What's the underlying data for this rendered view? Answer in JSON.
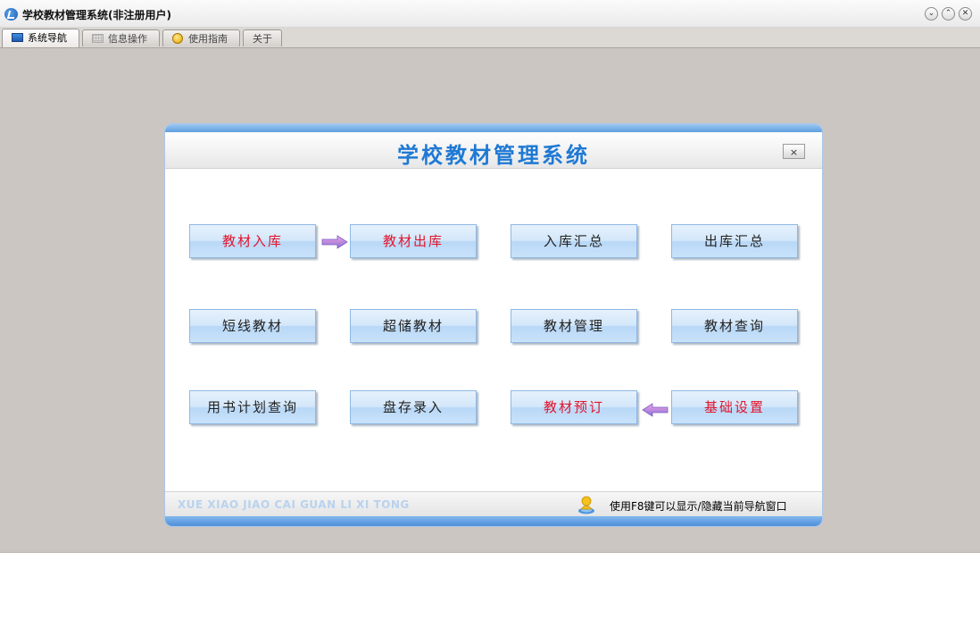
{
  "window": {
    "title": "学校教材管理系统(非注册用户)",
    "controls": [
      "⌄",
      "⌃",
      "✕"
    ]
  },
  "tabs": [
    {
      "label": "系统导航",
      "icon": "monitor-icon",
      "active": true
    },
    {
      "label": "信息操作",
      "icon": "grid-icon",
      "active": false
    },
    {
      "label": "使用指南",
      "icon": "smiley-icon",
      "active": false
    },
    {
      "label": "关于",
      "icon": "",
      "active": false
    }
  ],
  "panel": {
    "title": "学校教材管理系统",
    "close_label": "×",
    "buttons": [
      {
        "label": "教材入库",
        "color": "#e3142c"
      },
      {
        "label": "教材出库",
        "color": "#e3142c"
      },
      {
        "label": "入库汇总",
        "color": "#222222"
      },
      {
        "label": "出库汇总",
        "color": "#222222"
      },
      {
        "label": "短线教材",
        "color": "#222222"
      },
      {
        "label": "超储教材",
        "color": "#222222"
      },
      {
        "label": "教材管理",
        "color": "#222222"
      },
      {
        "label": "教材查询",
        "color": "#222222"
      },
      {
        "label": "用书计划查询",
        "color": "#222222"
      },
      {
        "label": "盘存录入",
        "color": "#222222"
      },
      {
        "label": "教材预订",
        "color": "#e3142c"
      },
      {
        "label": "基础设置",
        "color": "#e3142c"
      }
    ],
    "footer": {
      "pinyin": "XUE XIAO JIAO CAI GUAN LI XI TONG",
      "hint": "使用F8键可以显示/隐藏当前导航窗口"
    }
  }
}
